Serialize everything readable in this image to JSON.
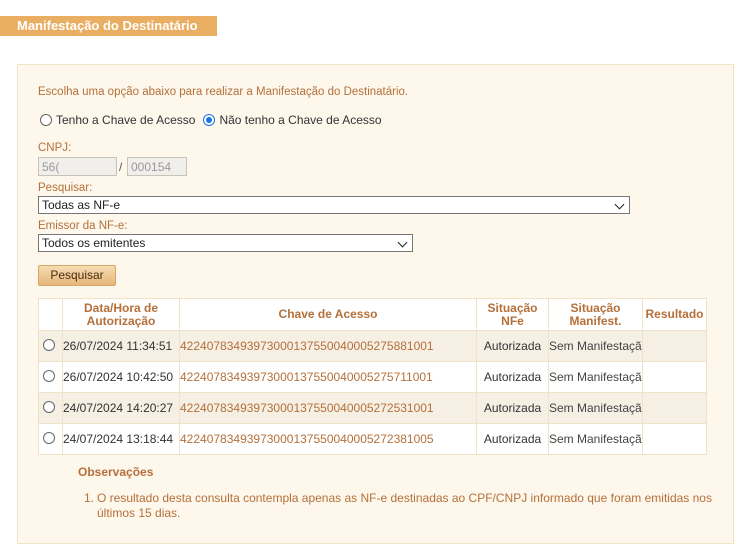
{
  "page": {
    "title": "Manifestação do Destinatário",
    "instruction": "Escolha uma opção abaixo para realizar a Manifestação do Destinatário."
  },
  "options": {
    "with_key": "Tenho a Chave de Acesso",
    "without_key": "Não tenho a Chave de Acesso",
    "selected": "without_key"
  },
  "form": {
    "cnpj_label": "CNPJ:",
    "cnpj_part1": "56(",
    "cnpj_separator": "/",
    "cnpj_part2": "000154",
    "pesquisar_label": "Pesquisar:",
    "pesquisar_value": "Todas as NF-e",
    "emissor_label": "Emissor da NF-e:",
    "emissor_value": "Todos os emitentes",
    "search_button": "Pesquisar"
  },
  "table": {
    "headers": {
      "datetime": "Data/Hora de Autorização",
      "key": "Chave de Acesso",
      "situacao_nfe": "Situação NFe",
      "situacao_manifest": "Situação Manifest.",
      "resultado": "Resultado"
    },
    "rows": [
      {
        "datetime": "26/07/2024 11:34:51",
        "key": "42240783493973000137550040005275881001",
        "situacao": "Autorizada",
        "manifest": "Sem Manifestação",
        "resultado": ""
      },
      {
        "datetime": "26/07/2024 10:42:50",
        "key": "42240783493973000137550040005275711001",
        "situacao": "Autorizada",
        "manifest": "Sem Manifestação",
        "resultado": ""
      },
      {
        "datetime": "24/07/2024 14:20:27",
        "key": "42240783493973000137550040005272531001",
        "situacao": "Autorizada",
        "manifest": "Sem Manifestação",
        "resultado": ""
      },
      {
        "datetime": "24/07/2024 13:18:44",
        "key": "42240783493973000137550040005272381005",
        "situacao": "Autorizada",
        "manifest": "Sem Manifestação",
        "resultado": ""
      }
    ]
  },
  "observations": {
    "title": "Observações",
    "items": [
      {
        "num": "1.",
        "text": "O resultado desta consulta contempla apenas as NF-e destinadas ao CPF/CNPJ informado que foram emitidas nos últimos 15 dias."
      }
    ]
  }
}
